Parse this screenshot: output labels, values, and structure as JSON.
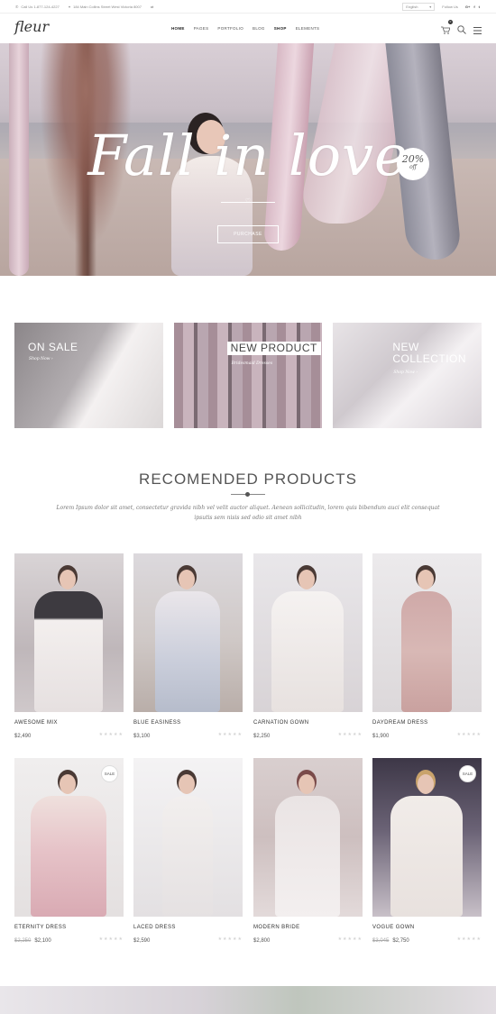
{
  "topbar": {
    "phone": "Call Us 1-877-124-4227",
    "address": "184 Main Collins Street West Victoria 8007",
    "language": "English",
    "follow_label": "Follow Us",
    "social": [
      "G+",
      "f",
      "t"
    ]
  },
  "header": {
    "logo": "fleur",
    "nav": [
      "HOME",
      "PAGES",
      "PORTFOLIO",
      "BLOG",
      "SHOP",
      "ELEMENTS"
    ],
    "cart_count": "0"
  },
  "hero": {
    "title": "Fall in love",
    "button": "PURCHASE",
    "badge_big": "20%",
    "badge_small": "off"
  },
  "banners": [
    {
      "title": "ON SALE",
      "sub": "Shop Now"
    },
    {
      "title": "NEW PRODUCT",
      "sub": "Bridesmaid Dresses"
    },
    {
      "title": "NEW COLLECTION",
      "sub": "Shop Now"
    }
  ],
  "section": {
    "title": "RECOMENDED PRODUCTS",
    "text": "Lorem Ipsum dolor sit amet, consectetur gravida nibh vel velit auctor aliquet. Aenean sollicitudin, lorem quis bibendum auci elit consequat ipsutis sem nisis sed odio sit amet nibh"
  },
  "products": [
    {
      "name": "AWESOME MIX",
      "price": "$2,490",
      "old": ""
    },
    {
      "name": "BLUE EASINESS",
      "price": "$3,100",
      "old": ""
    },
    {
      "name": "CARNATION GOWN",
      "price": "$2,250",
      "old": ""
    },
    {
      "name": "DAYDREAM DRESS",
      "price": "$1,900",
      "old": ""
    },
    {
      "name": "ETERNITY DRESS",
      "price": "$2,100",
      "old": "$2,250"
    },
    {
      "name": "LACED DRESS",
      "price": "$2,590",
      "old": ""
    },
    {
      "name": "MODERN BRIDE",
      "price": "$2,800",
      "old": ""
    },
    {
      "name": "VOGUE GOWN",
      "price": "$2,750",
      "old": "$3,045"
    }
  ],
  "sale_label": "SALE",
  "stars": "★★★★★",
  "colors": {
    "accent": "#333333",
    "hero_tint": "#c9bfc7"
  }
}
